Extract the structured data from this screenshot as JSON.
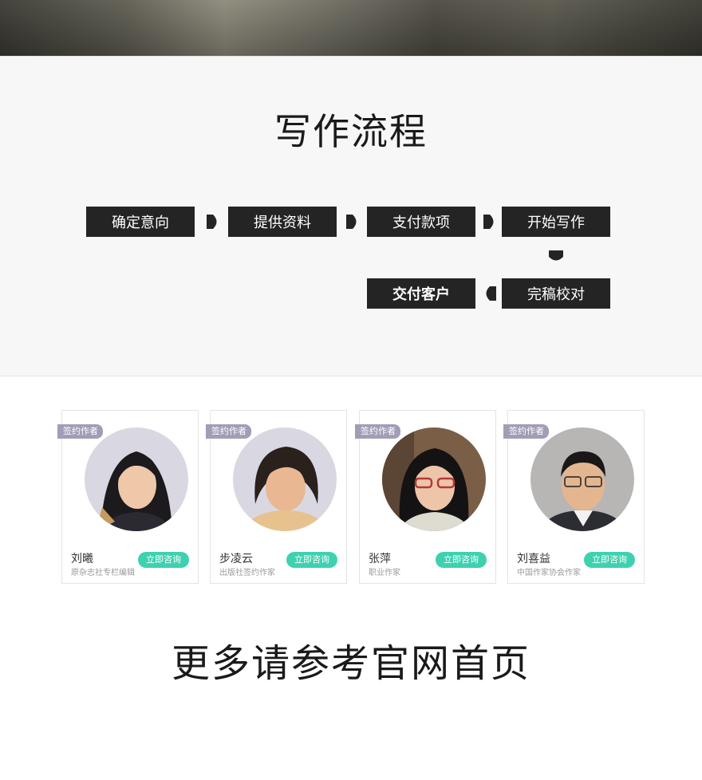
{
  "process": {
    "title": "写作流程",
    "steps": [
      "确定意向",
      "提供资料",
      "支付款项",
      "开始写作",
      "完稿校对",
      "交付客户"
    ]
  },
  "authors": [
    {
      "tag": "签约作者",
      "name": "刘曦",
      "title": "原杂志社专栏编辑",
      "button": "立即咨询"
    },
    {
      "tag": "签约作者",
      "name": "步凌云",
      "title": "出版社签约作家",
      "button": "立即咨询"
    },
    {
      "tag": "签约作者",
      "name": "张萍",
      "title": "职业作家",
      "button": "立即咨询"
    },
    {
      "tag": "签约作者",
      "name": "刘喜益",
      "title": "中国作家协会作家",
      "button": "立即咨询"
    }
  ],
  "footer": {
    "text": "更多请参考官网首页"
  },
  "colors": {
    "step_bg": "#242424",
    "consult": "#3ed1b0",
    "tag": "#a39cb6"
  }
}
